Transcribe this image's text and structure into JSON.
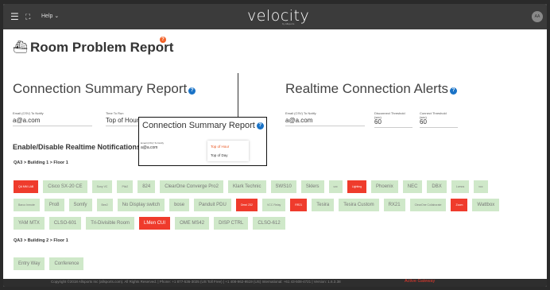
{
  "header": {
    "menu_icon": "hamburger-icon",
    "expand_icon": "expand-icon",
    "help_label": "Help",
    "logo": "velocity",
    "logo_sub": "by Allsports",
    "avatar_initials": "AA"
  },
  "page": {
    "title": "Room Problem Report",
    "title_icon": "room-icon"
  },
  "connection_summary": {
    "heading": "Connection Summary Report",
    "email_label": "Email (CSV) To Notify",
    "email_value": "a@a.com",
    "time_label": "Time To Run",
    "time_value": "Top of Hour"
  },
  "realtime_alerts": {
    "heading": "Realtime Connection Alerts",
    "email_label": "Email (CSV) To Notify",
    "email_value": "a@a.com",
    "disconnect_label": "Disconnect Threshold (sec)",
    "disconnect_value": "60",
    "connect_label": "Connect Threshold (sec)",
    "connect_value": "60"
  },
  "popup": {
    "heading": "Connection Summary Report",
    "email_label": "Email (CSV) To Notify",
    "email_value": "a@a.com",
    "options": [
      "Top of Hour",
      "Top of Day"
    ],
    "selected": "Top of Hour"
  },
  "notifications": {
    "heading": "Enable/Disable Realtime Notifications and",
    "groups": [
      {
        "path": "QA3 > Building 1 > Floor 1",
        "rows": [
          [
            {
              "label": "QA MM LAB",
              "on": true,
              "tiny": true
            },
            {
              "label": "Cisco SX-20 CE",
              "on": false
            },
            {
              "label": "Sony VC",
              "on": false,
              "tiny": true
            },
            {
              "label": "Ptlz2",
              "on": false,
              "tiny": true
            },
            {
              "label": "824",
              "on": false
            },
            {
              "label": "ClearOne Converge Pro2",
              "on": false
            },
            {
              "label": "Klark Technic",
              "on": false
            },
            {
              "label": "SWS10",
              "on": false
            },
            {
              "label": "Sklers",
              "on": false
            },
            {
              "label": "czc",
              "on": false,
              "tiny": true
            },
            {
              "label": "Lighting",
              "on": true,
              "tiny": true
            },
            {
              "label": "Phoenix",
              "on": false
            },
            {
              "label": "NEC",
              "on": false
            },
            {
              "label": "DBX",
              "on": false
            },
            {
              "label": "Lumos",
              "on": false,
              "tiny": true
            },
            {
              "label": "vcc",
              "on": false,
              "tiny": true
            }
          ],
          [
            {
              "label": "Barco Inmote",
              "on": false,
              "tiny": true
            },
            {
              "label": "Pro8",
              "on": false
            },
            {
              "label": "Somfy",
              "on": false
            },
            {
              "label": "Bee2",
              "on": false,
              "tiny": true
            },
            {
              "label": "No Display switch",
              "on": false
            },
            {
              "label": "bose",
              "on": false
            },
            {
              "label": "Panduit PDU",
              "on": false
            },
            {
              "label": "Omni 232",
              "on": true,
              "tiny": true
            },
            {
              "label": "VCC Relay",
              "on": false,
              "tiny": true
            },
            {
              "label": "RR21",
              "on": true,
              "tiny": true
            },
            {
              "label": "Tesira",
              "on": false
            },
            {
              "label": "Tesira Custom",
              "on": false
            },
            {
              "label": "RX21",
              "on": false
            },
            {
              "label": "ClearOne Collaborate",
              "on": false,
              "tiny": true
            },
            {
              "label": "Zoom",
              "on": true,
              "tiny": true
            },
            {
              "label": "Wattbox",
              "on": false
            }
          ],
          [
            {
              "label": "YAM MTX",
              "on": false
            },
            {
              "label": "CLSO-601",
              "on": false
            },
            {
              "label": "Tri-Divisible Room",
              "on": false
            },
            {
              "label": "LMen CUI",
              "on": true
            },
            {
              "label": "OME MS42",
              "on": false
            },
            {
              "label": "DISP CTRL",
              "on": false
            },
            {
              "label": "CLSO-612",
              "on": false
            }
          ]
        ]
      },
      {
        "path": "QA3 > Building 2 > Floor 1",
        "rows": [
          [
            {
              "label": "Entry Way",
              "on": false
            },
            {
              "label": "Conference",
              "on": false
            }
          ]
        ]
      }
    ]
  },
  "footer": {
    "text": "Copyright ©2018 Allsports Inc (allsports.com). All Rights Reserved. | Phone: +1 877-536-3025 (US Toll Free) | +1 408-962-9519 (US) International: +61 43-508-4721 | Version: 1.6.3.38",
    "link": "Active Gateway"
  },
  "colors": {
    "topbar": "#3b3b3b",
    "accent_red": "#ef3b2c",
    "chip_green": "#cfe8c9",
    "info_blue": "#1a73c7",
    "badge_orange": "#f3632a"
  }
}
